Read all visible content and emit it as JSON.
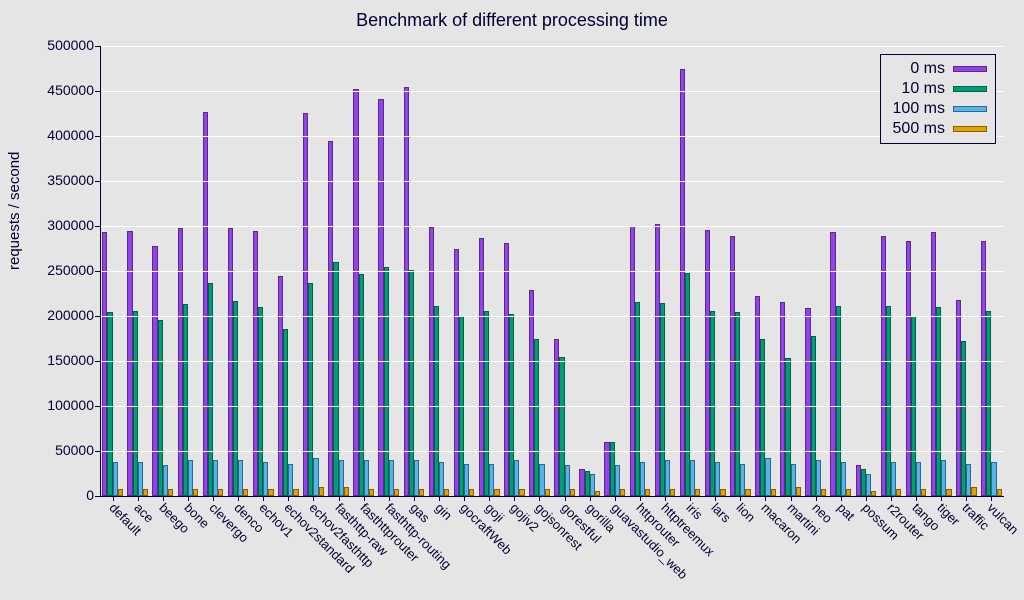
{
  "chart_data": {
    "type": "bar",
    "title": "Benchmark of different processing time",
    "xlabel": "",
    "ylabel": "requests / second",
    "ylim": [
      0,
      500000
    ],
    "yticks": [
      0,
      50000,
      100000,
      150000,
      200000,
      250000,
      300000,
      350000,
      400000,
      450000,
      500000
    ],
    "categories": [
      "default",
      "ace",
      "beego",
      "bone",
      "clevergo",
      "denco",
      "echov1",
      "echov2standard",
      "echov2fasthttp",
      "fasthttp-raw",
      "fasthttprouter",
      "fasthttp-routing",
      "gas",
      "gin",
      "gocraftWeb",
      "goji",
      "gojiv2",
      "gojsonrest",
      "gorestful",
      "gorilla",
      "guavastudio_web",
      "httprouter",
      "httptreemux",
      "iris",
      "lars",
      "lion",
      "macaron",
      "martini",
      "neo",
      "pat",
      "possum",
      "r2router",
      "tango",
      "tiger",
      "traffic",
      "vulcan"
    ],
    "series": [
      {
        "name": "0 ms",
        "color": "#9440ed",
        "values": [
          293000,
          295000,
          278000,
          298000,
          427000,
          298000,
          294000,
          244000,
          426000,
          395000,
          452000,
          441000,
          454000,
          299000,
          275000,
          287000,
          281000,
          229000,
          174000,
          30000,
          60000,
          300000,
          302000,
          474000,
          296000,
          289000,
          222000,
          216000,
          209000,
          293000,
          34000,
          289000,
          283000,
          293000,
          218000,
          283000
        ]
      },
      {
        "name": "10 ms",
        "color": "#009e73",
        "values": [
          204000,
          206000,
          196000,
          213000,
          237000,
          217000,
          210000,
          186000,
          237000,
          260000,
          247000,
          254000,
          251000,
          211000,
          200000,
          206000,
          202000,
          175000,
          155000,
          28000,
          60000,
          216000,
          214000,
          248000,
          206000,
          205000,
          174000,
          153000,
          178000,
          211000,
          30000,
          211000,
          200000,
          210000,
          172000,
          206000
        ]
      },
      {
        "name": "100 ms",
        "color": "#56b4e9",
        "values": [
          38000,
          38000,
          34000,
          40000,
          40000,
          40000,
          38000,
          36000,
          42000,
          40000,
          40000,
          40000,
          40000,
          38000,
          36000,
          36000,
          40000,
          36000,
          34000,
          24000,
          34000,
          38000,
          40000,
          40000,
          38000,
          36000,
          42000,
          36000,
          40000,
          38000,
          24000,
          38000,
          38000,
          40000,
          36000,
          38000
        ]
      },
      {
        "name": "500 ms",
        "color": "#e69f00",
        "values": [
          8000,
          8000,
          8000,
          8000,
          8000,
          8000,
          8000,
          8000,
          10000,
          10000,
          8000,
          8000,
          8000,
          8000,
          8000,
          8000,
          8000,
          8000,
          8000,
          6000,
          8000,
          8000,
          8000,
          8000,
          8000,
          8000,
          8000,
          10000,
          8000,
          8000,
          6000,
          8000,
          8000,
          8000,
          10000,
          8000
        ]
      }
    ],
    "legend_position": "top-right",
    "grid": true
  }
}
